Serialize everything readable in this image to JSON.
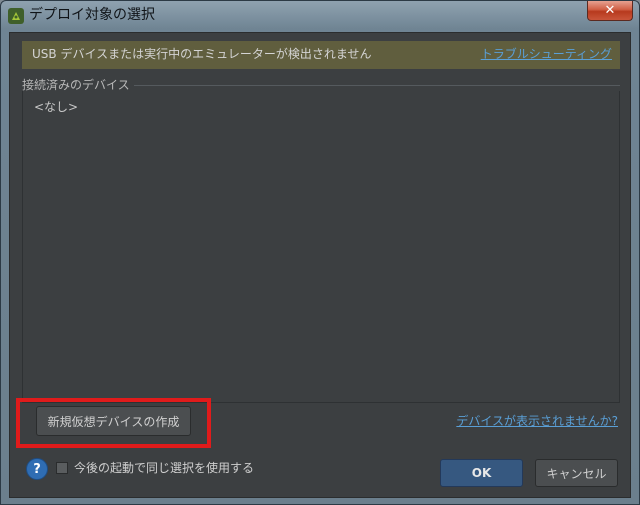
{
  "window": {
    "title": "デプロイ対象の選択",
    "close_glyph": "✕"
  },
  "warning": {
    "text": "USB デバイスまたは実行中のエミュレーターが検出されません",
    "link": "トラブルシューティング"
  },
  "devices": {
    "group_title": "接続済みのデバイス",
    "empty_text": "<なし>"
  },
  "actions": {
    "create_virtual_device": "新規仮想デバイスの作成",
    "not_shown_link": "デバイスが表示されませんか?"
  },
  "footer": {
    "help_glyph": "?",
    "reuse_checkbox_label": "今後の起動で同じ選択を使用する",
    "reuse_checked": false,
    "ok": "OK",
    "cancel": "キャンセル"
  },
  "colors": {
    "client_bg": "#3c3f41",
    "warning_bg": "#605e3e",
    "link": "#5a9fd6",
    "highlight": "#e01b1b",
    "ok_bg": "#365880"
  }
}
